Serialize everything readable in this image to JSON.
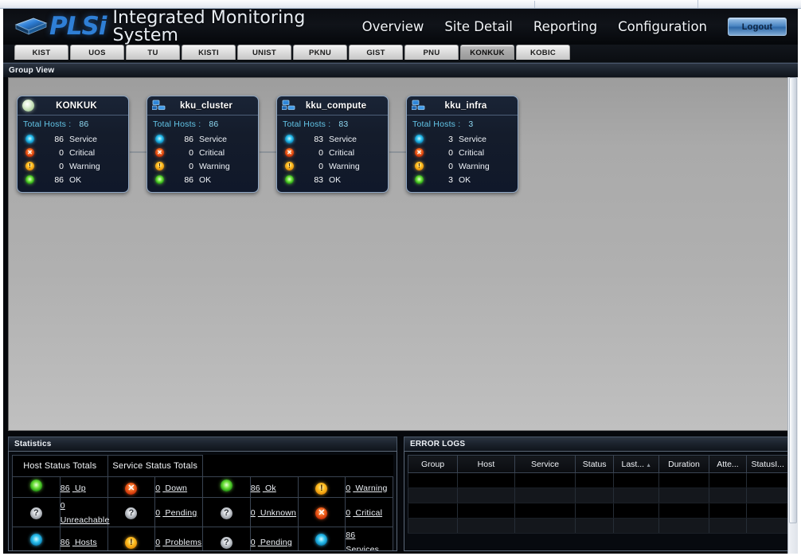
{
  "header": {
    "brand_plsi": "PLSi",
    "brand_title": "Integrated Monitoring System",
    "logo_icon": "plsi-logo-icon",
    "nav": [
      {
        "label": "Overview"
      },
      {
        "label": "Site Detail"
      },
      {
        "label": "Reporting"
      },
      {
        "label": "Configuration"
      }
    ],
    "logout_label": "Logout"
  },
  "site_tabs": [
    {
      "label": "KIST",
      "active": false
    },
    {
      "label": "UOS",
      "active": false
    },
    {
      "label": "TU",
      "active": false
    },
    {
      "label": "KISTI",
      "active": false
    },
    {
      "label": "UNIST",
      "active": false
    },
    {
      "label": "PKNU",
      "active": false
    },
    {
      "label": "GIST",
      "active": false
    },
    {
      "label": "PNU",
      "active": false
    },
    {
      "label": "KONKUK",
      "active": true
    },
    {
      "label": "KOBIC",
      "active": false
    }
  ],
  "group_view": {
    "title": "Group View",
    "total_hosts_label": "Total Hosts :",
    "panels": [
      {
        "name": "KONKUK",
        "icon": "globe-icon",
        "root": true,
        "total_hosts": "86",
        "rows": [
          {
            "icon": "service-icon",
            "count": "86",
            "label": "Service"
          },
          {
            "icon": "critical-icon",
            "count": "0",
            "label": "Critical"
          },
          {
            "icon": "warning-icon",
            "count": "0",
            "label": "Warning"
          },
          {
            "icon": "ok-icon",
            "count": "86",
            "label": "OK"
          }
        ]
      },
      {
        "name": "kku_cluster",
        "icon": "network-icon",
        "root": false,
        "total_hosts": "86",
        "rows": [
          {
            "icon": "service-icon",
            "count": "86",
            "label": "Service"
          },
          {
            "icon": "critical-icon",
            "count": "0",
            "label": "Critical"
          },
          {
            "icon": "warning-icon",
            "count": "0",
            "label": "Warning"
          },
          {
            "icon": "ok-icon",
            "count": "86",
            "label": "OK"
          }
        ]
      },
      {
        "name": "kku_compute",
        "icon": "network-icon",
        "root": false,
        "total_hosts": "83",
        "rows": [
          {
            "icon": "service-icon",
            "count": "83",
            "label": "Service"
          },
          {
            "icon": "critical-icon",
            "count": "0",
            "label": "Critical"
          },
          {
            "icon": "warning-icon",
            "count": "0",
            "label": "Warning"
          },
          {
            "icon": "ok-icon",
            "count": "83",
            "label": "OK"
          }
        ]
      },
      {
        "name": "kku_infra",
        "icon": "network-icon",
        "root": false,
        "total_hosts": "3",
        "rows": [
          {
            "icon": "service-icon",
            "count": "3",
            "label": "Service"
          },
          {
            "icon": "critical-icon",
            "count": "0",
            "label": "Critical"
          },
          {
            "icon": "warning-icon",
            "count": "0",
            "label": "Warning"
          },
          {
            "icon": "ok-icon",
            "count": "3",
            "label": "OK"
          }
        ]
      }
    ]
  },
  "statistics": {
    "title": "Statistics",
    "headers": [
      "Host Status Totals",
      "Service Status Totals"
    ],
    "rows": [
      [
        {
          "icon": "up-icon",
          "count": "86",
          "label": "Up"
        },
        {
          "icon": "down-icon",
          "count": "0",
          "label": "Down"
        },
        {
          "icon": "ok-icon",
          "count": "86",
          "label": "Ok"
        },
        {
          "icon": "warning-icon",
          "count": "0",
          "label": "Warning"
        }
      ],
      [
        {
          "icon": "unknown-icon",
          "count": "0",
          "label": "Unreachable"
        },
        {
          "icon": "unknown-icon",
          "count": "0",
          "label": "Pending"
        },
        {
          "icon": "unknown-icon",
          "count": "0",
          "label": "Unknown"
        },
        {
          "icon": "critical-icon",
          "count": "0",
          "label": "Critical"
        }
      ],
      [
        {
          "icon": "hosts-icon",
          "count": "86",
          "label": "Hosts"
        },
        {
          "icon": "problems-icon",
          "count": "0",
          "label": "Problems"
        },
        {
          "icon": "unknown-icon",
          "count": "0",
          "label": "Pending"
        },
        {
          "icon": "services-icon",
          "count": "86",
          "label": "Services"
        }
      ]
    ]
  },
  "error_logs": {
    "title": "ERROR LOGS",
    "columns": [
      {
        "label": "Group",
        "sorted": false
      },
      {
        "label": "Host",
        "sorted": false
      },
      {
        "label": "Service",
        "sorted": false
      },
      {
        "label": "Status",
        "sorted": false
      },
      {
        "label": "Last...",
        "sorted": true
      },
      {
        "label": "Duration",
        "sorted": false
      },
      {
        "label": "Atte...",
        "sorted": false
      },
      {
        "label": "StatusI...",
        "sorted": false
      }
    ],
    "sort_caret": "▲",
    "rows": [],
    "empty_row_count": 4
  },
  "colors": {
    "accent_blue": "#2f7fd6",
    "cyan": "#2fc4ef",
    "green": "#6ce03a",
    "red": "#f36a20",
    "orange": "#ffc326",
    "panel_bg": "#141c2b",
    "panel_border": "#8fa7c4"
  }
}
